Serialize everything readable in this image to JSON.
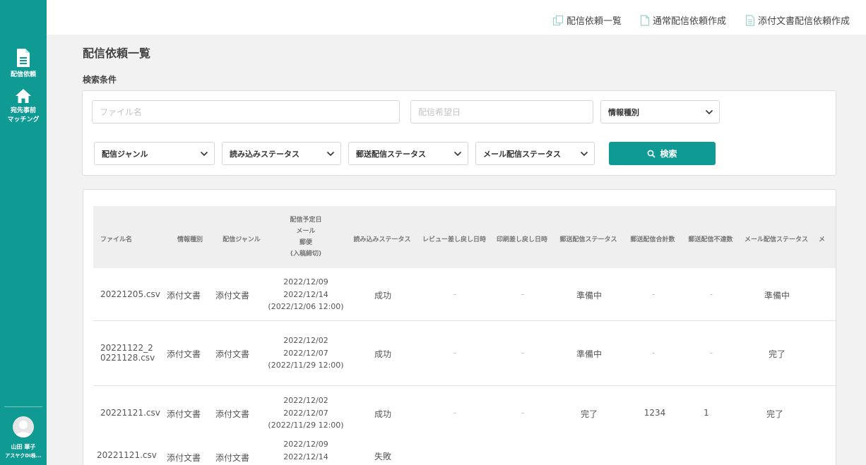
{
  "sidebar": {
    "items": [
      {
        "label": "配信依頼",
        "icon": "document-icon"
      },
      {
        "label": "宛先事前\nマッチング",
        "icon": "home-icon"
      }
    ],
    "user": {
      "name": "山田 華子",
      "company": "アスヤクDI株..."
    }
  },
  "topnav": [
    {
      "label": "配信依頼一覧",
      "icon": "copy-documents-icon"
    },
    {
      "label": "通常配信依頼作成",
      "icon": "new-file-icon"
    },
    {
      "label": "添付文書配信依頼作成",
      "icon": "attached-document-icon"
    }
  ],
  "page": {
    "title": "配信依頼一覧",
    "section": "検索条件"
  },
  "search": {
    "filename_placeholder": "ファイル名",
    "date_placeholder": "配信希望日",
    "info_type": "情報種別",
    "genre": "配信ジャンル",
    "read_status": "読み込みステータス",
    "mail_status": "郵送配信ステータス",
    "email_status": "メール配信ステータス",
    "button": "検索"
  },
  "table": {
    "headers": {
      "filename": "ファイル名",
      "info_type": "情報種別",
      "genre": "配信ジャンル",
      "date_lines": [
        "配信予定日",
        "メール",
        "郵便",
        "(入稿締切)"
      ],
      "read_status": "読み込みステータス",
      "review_return": "レビュー差し戻し日時",
      "print_return": "印刷差し戻し日時",
      "post_status": "郵送配信ステータス",
      "post_total": "郵送配信合計数",
      "post_undelivered": "郵送配信不達数",
      "email_status": "メール配信ステータス",
      "more": "メ"
    },
    "rows": [
      {
        "filename": "20221205.csv",
        "info_type": "添付文書",
        "genre": "添付文書",
        "date_mail": "2022/12/09",
        "date_post": "2022/12/14",
        "deadline": "(2022/12/06 12:00)",
        "read_status": "成功",
        "review": "-",
        "print": "-",
        "post_status": "準備中",
        "post_total": "-",
        "post_undelivered": "-",
        "email_status": "準備中"
      },
      {
        "filename_lines": [
          "20221122_2",
          "0221128.csv"
        ],
        "info_type": "添付文書",
        "genre": "添付文書",
        "date_mail": "2022/12/02",
        "date_post": "2022/12/07",
        "deadline": "(2022/11/29 12:00)",
        "read_status": "成功",
        "review": "-",
        "print": "-",
        "post_status": "準備中",
        "post_total": "-",
        "post_undelivered": "-",
        "email_status": "完了"
      },
      {
        "filename": "20221121.csv",
        "info_type": "添付文書",
        "genre": "添付文書",
        "date_mail": "2022/12/02",
        "date_post": "2022/12/07",
        "deadline": "(2022/11/29 12:00)",
        "read_status": "成功",
        "review": "-",
        "print": "-",
        "post_status": "完了",
        "post_total": "1234",
        "post_undelivered": "1",
        "email_status": "完了"
      },
      {
        "filename": "20221121.csv",
        "info_type": "添付文書",
        "genre": "添付文書",
        "date_mail": "2022/12/09",
        "date_post": "2022/12/14",
        "read_status": "失敗"
      }
    ]
  },
  "colors": {
    "primary": "#0f9a93",
    "background": "#f2f2f2"
  }
}
